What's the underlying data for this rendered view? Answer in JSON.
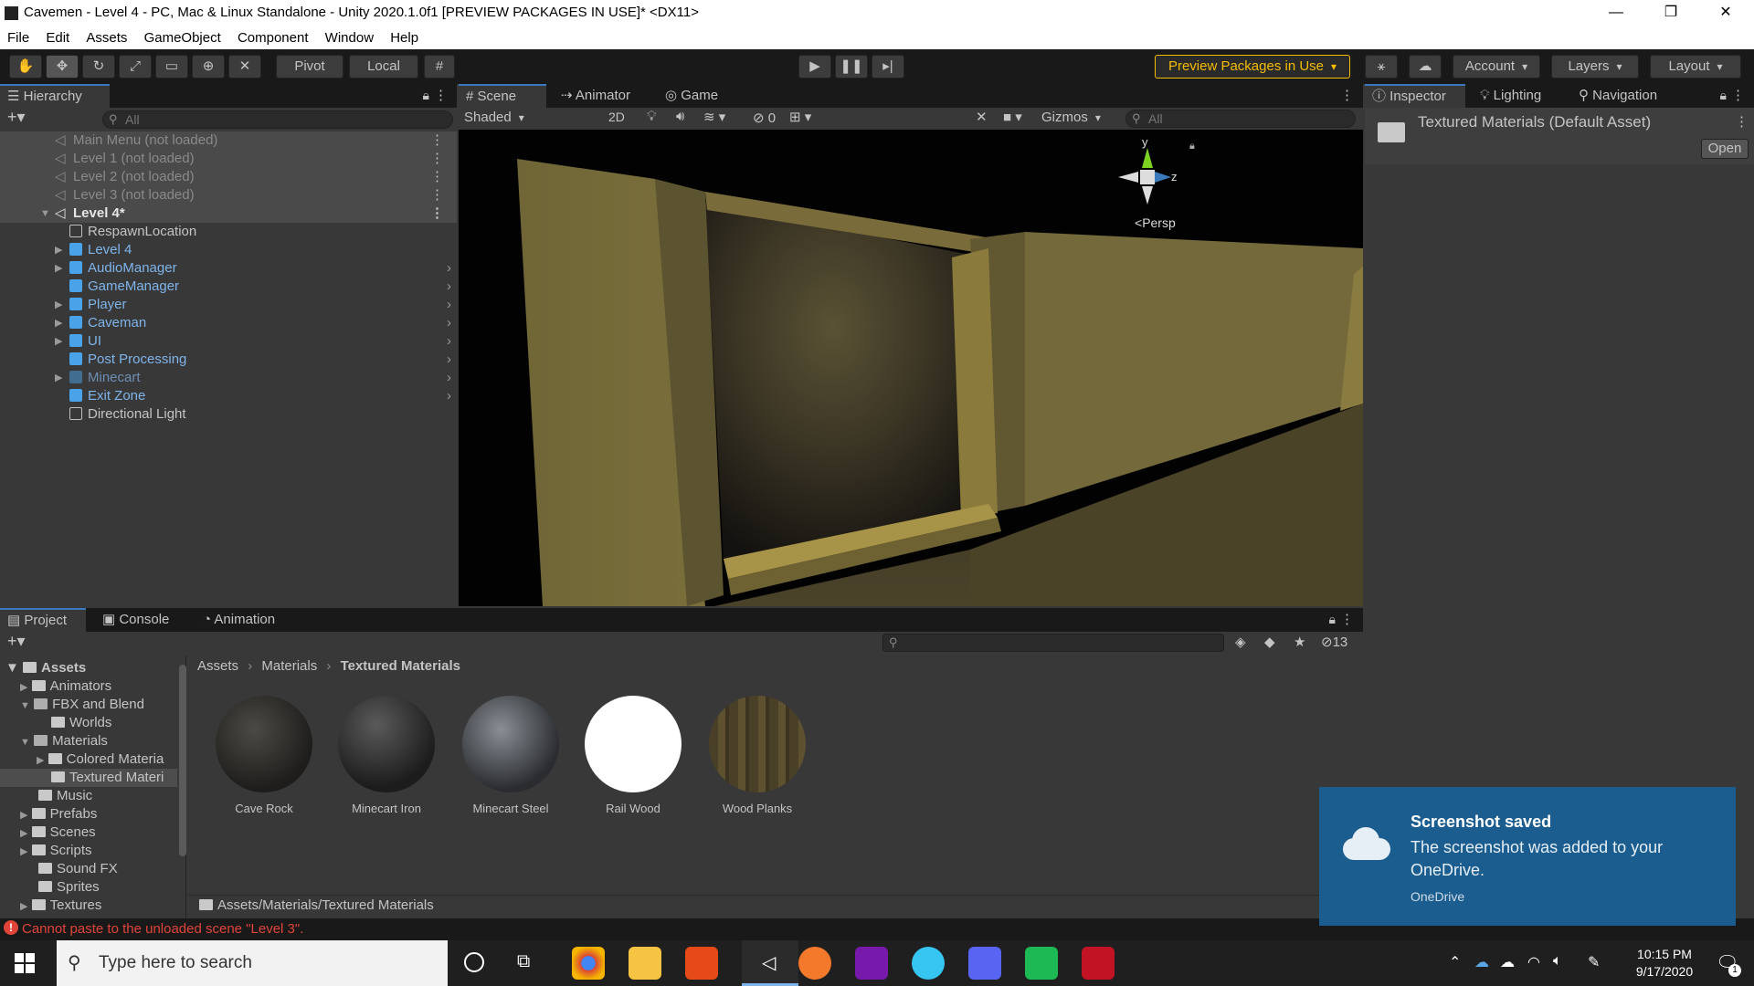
{
  "window": {
    "title": "Cavemen - Level 4 - PC, Mac & Linux Standalone - Unity 2020.1.0f1 [PREVIEW PACKAGES IN USE]* <DX11>",
    "minimize": "—",
    "maximize": "❐",
    "close": "✕"
  },
  "menu": [
    "File",
    "Edit",
    "Assets",
    "GameObject",
    "Component",
    "Window",
    "Help"
  ],
  "toolbar": {
    "pivot": "Pivot",
    "local": "Local",
    "preview_packages": "Preview Packages in Use",
    "account": "Account",
    "layers": "Layers",
    "layout": "Layout"
  },
  "hierarchy": {
    "tab": "Hierarchy",
    "search_placeholder": "All",
    "scenes": [
      "Main Menu (not loaded)",
      "Level 1 (not loaded)",
      "Level 2 (not loaded)",
      "Level 3 (not loaded)"
    ],
    "active_scene": "Level 4*",
    "items": [
      "RespawnLocation",
      "Level 4",
      "AudioManager",
      "GameManager",
      "Player",
      "Caveman",
      "UI",
      "Post Processing",
      "Minecart",
      "Exit Zone",
      "Directional Light"
    ]
  },
  "scene_view": {
    "tabs": [
      "Scene",
      "Animator",
      "Game"
    ],
    "shading": "Shaded",
    "mode_2d": "2D",
    "hidden_count": "0",
    "gizmos": "Gizmos",
    "search_placeholder": "All",
    "gizmo_y": "y",
    "gizmo_z": "z",
    "persp": "Persp"
  },
  "inspector": {
    "tabs": [
      "Inspector",
      "Lighting",
      "Navigation"
    ],
    "asset_title": "Textured Materials (Default Asset)",
    "open_button": "Open"
  },
  "project": {
    "tabs": [
      "Project",
      "Console",
      "Animation"
    ],
    "hidden_count": "13",
    "tree": [
      {
        "label": "Assets",
        "level": 0,
        "expanded": true
      },
      {
        "label": "Animators",
        "level": 1,
        "expanded": false
      },
      {
        "label": "FBX and Blend",
        "level": 1,
        "expanded": true
      },
      {
        "label": "Worlds",
        "level": 2,
        "expanded": false
      },
      {
        "label": "Materials",
        "level": 1,
        "expanded": true
      },
      {
        "label": "Colored Materia",
        "level": 2,
        "expanded": false
      },
      {
        "label": "Textured Materi",
        "level": 2,
        "expanded": false
      },
      {
        "label": "Music",
        "level": 1,
        "expanded": false
      },
      {
        "label": "Prefabs",
        "level": 1,
        "expanded": false
      },
      {
        "label": "Scenes",
        "level": 1,
        "expanded": false
      },
      {
        "label": "Scripts",
        "level": 1,
        "expanded": false
      },
      {
        "label": "Sound FX",
        "level": 1,
        "expanded": false
      },
      {
        "label": "Sprites",
        "level": 1,
        "expanded": false
      },
      {
        "label": "Textures",
        "level": 1,
        "expanded": false
      }
    ],
    "breadcrumb": [
      "Assets",
      "Materials",
      "Textured Materials"
    ],
    "materials": [
      "Cave Rock",
      "Minecart Iron",
      "Minecart Steel",
      "Rail Wood",
      "Wood Planks"
    ],
    "footer_path": "Assets/Materials/Textured Materials"
  },
  "status": {
    "error": "Cannot paste to the unloaded scene \"Level 3\"."
  },
  "toast": {
    "title": "Screenshot saved",
    "body": "The screenshot was added to your OneDrive.",
    "source": "OneDrive"
  },
  "taskbar": {
    "search_placeholder": "Type here to search",
    "time": "10:15 PM",
    "date": "9/17/2020",
    "notification_count": "1"
  },
  "colors": {
    "accent": "#3a79bb",
    "error": "#e0443a",
    "preview_packages": "#f4bc02",
    "toast": "#1b5d8f"
  }
}
